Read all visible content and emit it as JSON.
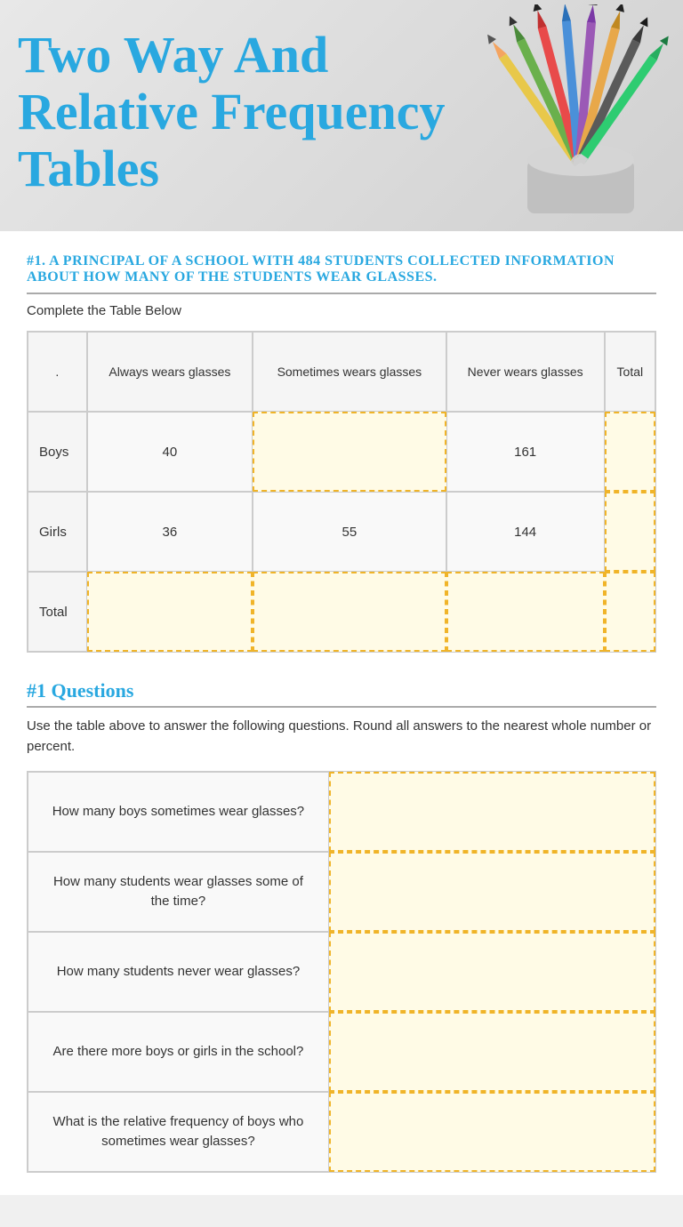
{
  "header": {
    "title_line1": "Two Way and",
    "title_line2": "Relative Frequency",
    "title_line3": "Tables"
  },
  "problem1": {
    "question_number": "#1. A principal of a school with 484 students collected information about how many of the students wear glasses.",
    "complete_label": "Complete the Table Below",
    "table": {
      "headers": [
        ".",
        "Always wears glasses",
        "Sometimes wears glasses",
        "Never wears glasses",
        "Total"
      ],
      "rows": [
        {
          "label": "Boys",
          "always": "40",
          "sometimes": "",
          "never": "161",
          "total": ""
        },
        {
          "label": "Girls",
          "always": "36",
          "sometimes": "55",
          "never": "144",
          "total": ""
        },
        {
          "label": "Total",
          "always": "",
          "sometimes": "",
          "never": "",
          "total": ""
        }
      ]
    }
  },
  "questions_section": {
    "title": "#1 Questions",
    "description": "Use the table above to answer the following questions. Round all answers to the nearest whole number or percent.",
    "questions": [
      "How many boys sometimes wear glasses?",
      "How many students wear glasses some of the time?",
      "How many students never wear glasses?",
      "Are there more boys or girls in the school?",
      "What is the relative frequency of boys who sometimes wear"
    ]
  }
}
